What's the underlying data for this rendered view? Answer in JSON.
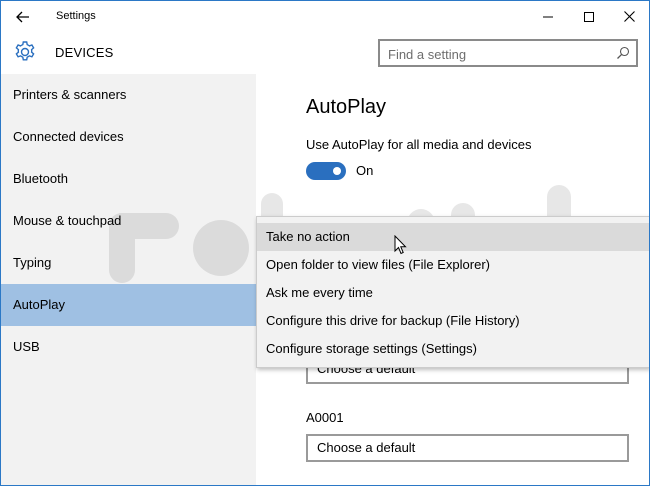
{
  "window": {
    "title": "Settings"
  },
  "header": {
    "section_title": "DEVICES",
    "search_placeholder": "Find a setting"
  },
  "sidebar": {
    "items": [
      {
        "label": "Printers & scanners"
      },
      {
        "label": "Connected devices"
      },
      {
        "label": "Bluetooth"
      },
      {
        "label": "Mouse & touchpad"
      },
      {
        "label": "Typing"
      },
      {
        "label": "AutoPlay",
        "selected": true
      },
      {
        "label": "USB"
      }
    ]
  },
  "main": {
    "page_title": "AutoPlay",
    "autoplay_setting_label": "Use AutoPlay for all media and devices",
    "toggle_state": "On",
    "toggle_on": true,
    "removable_drive_dropdown": "Choose a default",
    "drive_label": "A0001",
    "drive_dropdown": "Choose a default"
  },
  "context_menu": {
    "items": [
      {
        "label": "Take no action",
        "highlighted": true
      },
      {
        "label": "Open folder to view files (File Explorer)"
      },
      {
        "label": "Ask me every time"
      },
      {
        "label": "Configure this drive for backup (File History)"
      },
      {
        "label": "Configure storage settings (Settings)"
      }
    ]
  },
  "colors": {
    "accent": "#2a6fbf",
    "sidebar_bg": "#f2f2f2",
    "selected_bg": "#9fc0e3",
    "window_border": "#2b78c6"
  },
  "icons": {
    "back": "back-arrow-icon",
    "minimize": "minimize-icon",
    "maximize": "maximize-icon",
    "close": "close-icon",
    "devices": "gear-icon",
    "search": "search-icon"
  }
}
